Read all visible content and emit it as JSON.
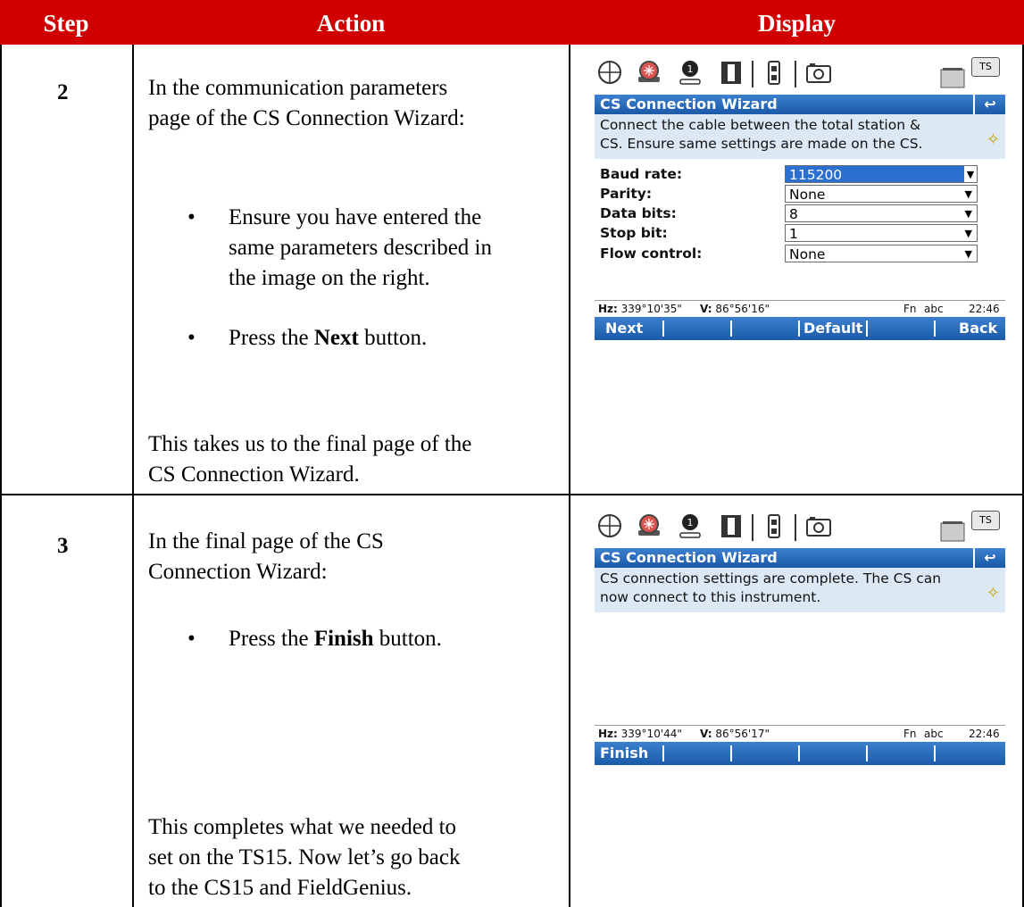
{
  "header": {
    "step": "Step",
    "action": "Action",
    "display": "Display"
  },
  "rows": [
    {
      "step": "2",
      "intro_line1": "In the communication parameters",
      "intro_line2": "page of the CS Connection Wizard:",
      "bullet1_line1": "Ensure you have entered the",
      "bullet1_line2": "same parameters described in",
      "bullet1_line3": "the image on the right.",
      "bullet2_pre": "Press the ",
      "bullet2_key": "Next",
      "bullet2_post": " button.",
      "outro_line1": "This takes us to the final page of the",
      "outro_line2": "CS Connection Wizard.",
      "screen": {
        "title": "CS Connection Wizard",
        "back_glyph": "↩",
        "info_line1": "Connect the cable between the total station &",
        "info_line2": "CS. Ensure same settings are made on the CS.",
        "fields": [
          {
            "label": "Baud rate:",
            "value": "115200"
          },
          {
            "label": "Parity:",
            "value": "None"
          },
          {
            "label": "Data bits:",
            "value": "8"
          },
          {
            "label": "Stop bit:",
            "value": "1"
          },
          {
            "label": "Flow control:",
            "value": "None"
          }
        ],
        "hz_label": "Hz:",
        "hz_value": "339°10'35\"",
        "v_label": "V:",
        "v_value": "86°56'16\"",
        "fn": "Fn",
        "abc": "abc",
        "time": "22:46",
        "softkeys": {
          "f1": "Next",
          "f4": "Default",
          "f6": "Back"
        }
      }
    },
    {
      "step": "3",
      "intro_line1": "In the final page of the CS",
      "intro_line2": "Connection Wizard:",
      "bullet1_pre": "Press the ",
      "bullet1_key": "Finish",
      "bullet1_post": " button.",
      "outro_line1": "This completes what we needed to",
      "outro_line2": "set on the TS15.  Now let’s go back",
      "outro_line3": "to the CS15 and FieldGenius.",
      "screen": {
        "title": "CS Connection Wizard",
        "back_glyph": "↩",
        "info_line1": "CS connection settings are complete. The CS can",
        "info_line2": "now connect to this instrument.",
        "hz_label": "Hz:",
        "hz_value": "339°10'44\"",
        "v_label": "V:",
        "v_value": "86°56'17\"",
        "fn": "Fn",
        "abc": "abc",
        "time": "22:46",
        "softkeys": {
          "f1": "Finish"
        }
      }
    }
  ],
  "toolbar_icons": [
    "crosshair-icon",
    "prism-icon",
    "target-height-icon",
    "instrument-icon",
    "battery-icon",
    "camera-icon",
    "memory-card-icon",
    "ts-badge-icon"
  ],
  "ts_badge": "TS",
  "colors": {
    "header_bg": "#d10000",
    "bar_blue": "#1a5aa8",
    "info_bg": "#dde8f5"
  }
}
